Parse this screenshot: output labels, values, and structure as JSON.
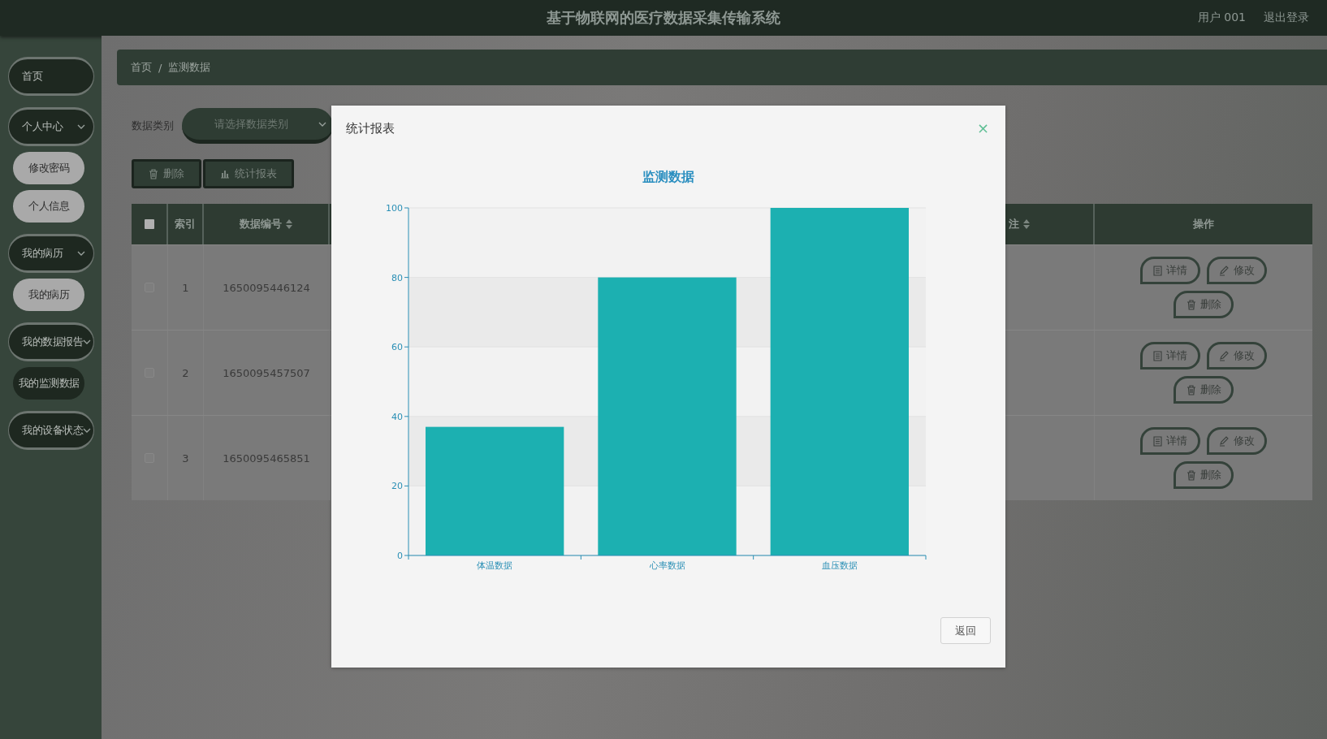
{
  "header": {
    "title": "基于物联网的医疗数据采集传输系统",
    "user": "用户 001",
    "logout": "退出登录"
  },
  "sidebar": {
    "items": [
      {
        "label": "首页",
        "kind": "menu",
        "expandable": false
      },
      {
        "label": "个人中心",
        "kind": "menu",
        "expandable": true
      },
      {
        "label": "修改密码",
        "kind": "sub",
        "selected": false
      },
      {
        "label": "个人信息",
        "kind": "sub",
        "selected": false
      },
      {
        "label": "我的病历",
        "kind": "menu",
        "expandable": true
      },
      {
        "label": "我的病历",
        "kind": "sub",
        "selected": false
      },
      {
        "label": "我的数据报告",
        "kind": "menu",
        "expandable": true
      },
      {
        "label": "我的监测数据",
        "kind": "sub",
        "selected": true
      },
      {
        "label": "我的设备状态",
        "kind": "menu",
        "expandable": true
      }
    ]
  },
  "breadcrumb": {
    "items": [
      "首页",
      "监测数据"
    ],
    "separator": "/"
  },
  "filter": {
    "label": "数据类别",
    "placeholder": "请选择数据类别"
  },
  "toolbar": [
    {
      "kind": "delete",
      "label": "删除"
    },
    {
      "kind": "chart",
      "label": "统计报表"
    }
  ],
  "table": {
    "header_checkbox": {
      "checked": false
    },
    "columns": [
      {
        "label": "索引",
        "sortable": false
      },
      {
        "label": "数据编号",
        "sortable": true
      },
      {
        "label": "注",
        "sortable": true
      },
      {
        "label": "操作",
        "sortable": false
      }
    ],
    "rows": [
      {
        "checked": false,
        "index": "1",
        "number": "1650095446124",
        "actions": [
          {
            "kind": "detail",
            "label": "详情"
          },
          {
            "kind": "edit",
            "label": "修改"
          },
          {
            "kind": "delete",
            "label": "删除"
          }
        ]
      },
      {
        "checked": false,
        "index": "2",
        "number": "1650095457507",
        "actions": [
          {
            "kind": "detail",
            "label": "详情"
          },
          {
            "kind": "edit",
            "label": "修改"
          },
          {
            "kind": "delete",
            "label": "删除"
          }
        ]
      },
      {
        "checked": false,
        "index": "3",
        "number": "1650095465851",
        "actions": [
          {
            "kind": "detail",
            "label": "详情"
          },
          {
            "kind": "edit",
            "label": "修改"
          },
          {
            "kind": "delete",
            "label": "删除"
          }
        ]
      }
    ]
  },
  "dialog": {
    "title": "统计报表",
    "close": "×",
    "back_button": "返回",
    "chart_data": {
      "type": "bar",
      "title": "监测数据",
      "categories": [
        "体温数据",
        "心率数据",
        "血压数据"
      ],
      "series": [
        {
          "color": "#1cb0b1",
          "values": [
            37,
            80,
            100
          ]
        }
      ],
      "ylim": [
        0,
        100
      ],
      "yticks": [
        0,
        20,
        40,
        60,
        80,
        100
      ],
      "grid": true
    }
  }
}
